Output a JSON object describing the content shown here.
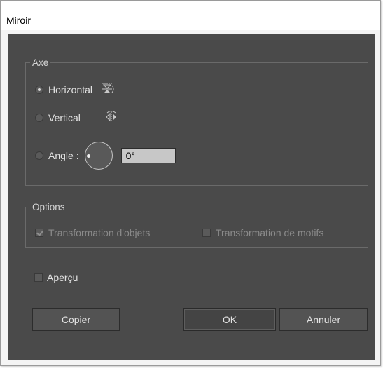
{
  "window": {
    "title": "Miroir"
  },
  "axe": {
    "legend": "Axe",
    "horizontal_label": "Horizontal",
    "vertical_label": "Vertical",
    "angle_label": "Angle :",
    "angle_value": "0°",
    "selected": "horizontal"
  },
  "options": {
    "legend": "Options",
    "transform_objects_label": "Transformation d'objets",
    "transform_objects_checked": true,
    "transform_patterns_label": "Transformation de motifs",
    "transform_patterns_checked": false
  },
  "preview": {
    "label": "Aperçu",
    "checked": false
  },
  "buttons": {
    "copy": "Copier",
    "ok": "OK",
    "cancel": "Annuler"
  }
}
